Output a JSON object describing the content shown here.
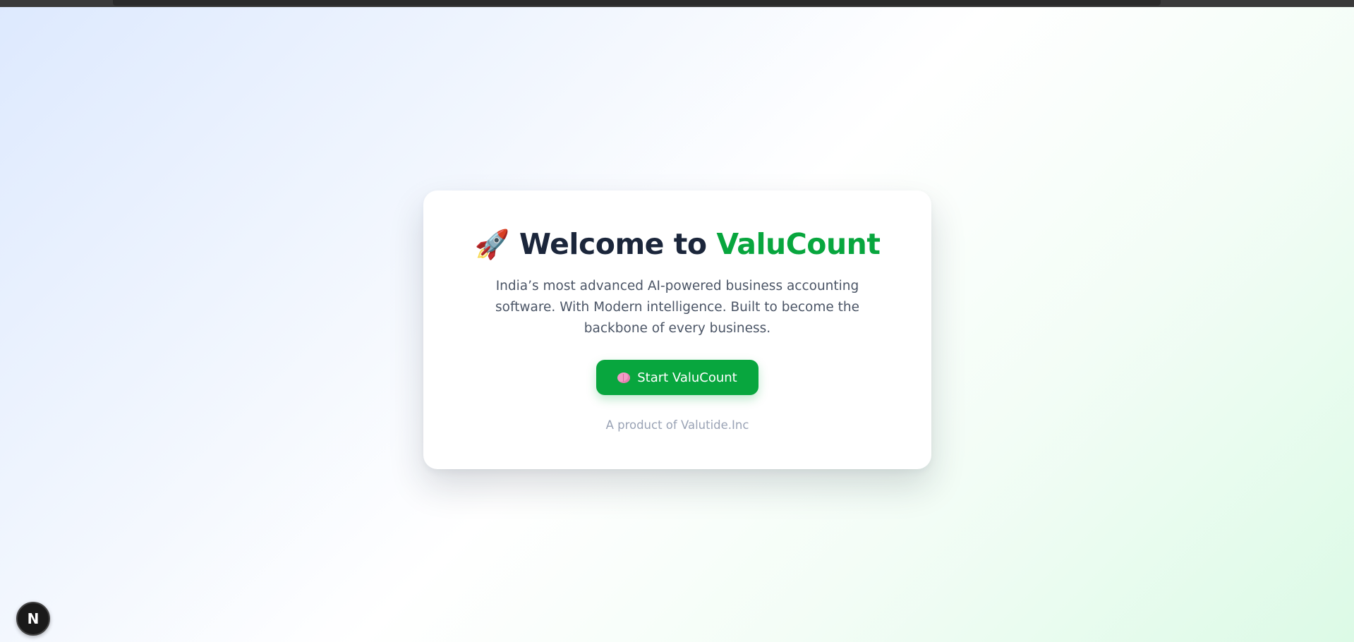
{
  "welcome": {
    "title_prefix": "Welcome to",
    "title_brand": "ValuCount",
    "rocket_glyph": "🚀",
    "description": "India’s most advanced AI-powered business accounting software. With Modern intelligence. Built to become the backbone of every business.",
    "cta_label": "Start ValuCount",
    "footer": "A product of Valutide.Inc"
  },
  "dev_badge": {
    "label": "N"
  },
  "colors": {
    "brand_green": "#08a63e",
    "title_dark": "#1b263b"
  },
  "icons": {
    "title_icon": "rocket-icon",
    "cta_icon": "brain-icon",
    "dev_badge_icon": "nextjs-icon"
  }
}
